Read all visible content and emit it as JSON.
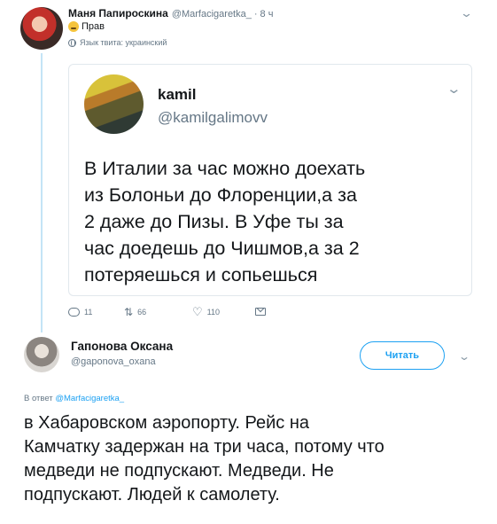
{
  "tweet1": {
    "author_name": "Маня Папироскина",
    "author_handle": "@Marfacigaretka_",
    "separator": "·",
    "time": "8 ч",
    "text": "Прав",
    "language_note": "Язык твита: украинский"
  },
  "quoted_tweet": {
    "author_name": "kamil",
    "author_handle": "@kamilgalimovv",
    "text": "В Италии за час можно доехать\nиз Болоньи до Флоренции,а за\n2 даже до Пизы. В Уфе ты за\nчас доедешь до Чишмов,а за 2\nпотеряешься и сопьешься"
  },
  "actions": {
    "replies": "11",
    "retweets": "66",
    "likes": "110"
  },
  "tweet2": {
    "author_name": "Гапонова Оксана",
    "author_handle": "@gaponova_oxana",
    "follow_label": "Читать",
    "reply_prefix": "В ответ",
    "reply_handle": "@Marfacigaretka_",
    "text": "в Хабаровском аэропорту. Рейс на\nКамчатку задержан на три часа, потому что\nмедведи не подпускают. Медведи. Не\nподпускают. Людей к самолету."
  },
  "icons": [
    "chevron-down-icon",
    "emoji-icon",
    "globe-icon",
    "reply-icon",
    "retweet-icon",
    "like-icon",
    "message-icon"
  ],
  "colors": {
    "accent": "#1da1f2",
    "secondary_text": "#657786",
    "primary_text": "#14171a",
    "thread_line": "#c4e4f6"
  }
}
